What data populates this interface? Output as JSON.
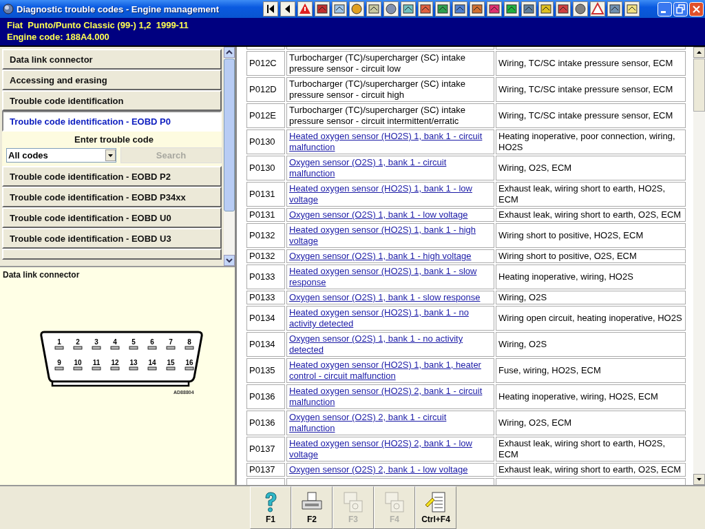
{
  "window": {
    "title": "Diagnostic trouble codes - Engine management"
  },
  "vehicle": {
    "model": "Fiat  Punto/Punto Classic (99-) 1,2  1999-11",
    "engine_code": "Engine code: 188A4.000"
  },
  "menu": [
    {
      "label": "Data link connector",
      "selected": false
    },
    {
      "label": "Accessing and erasing",
      "selected": false
    },
    {
      "label": "Trouble code identification",
      "selected": false
    },
    {
      "label": "Trouble code identification - EOBD P0",
      "selected": true
    },
    {
      "label": "Trouble code identification - EOBD P2",
      "selected": false
    },
    {
      "label": "Trouble code identification - EOBD P34xx",
      "selected": false
    },
    {
      "label": "Trouble code identification - EOBD U0",
      "selected": false
    },
    {
      "label": "Trouble code identification - EOBD U3",
      "selected": false
    }
  ],
  "code_search": {
    "title": "Enter trouble code",
    "filter": "All codes",
    "search_button": {
      "label": "Search",
      "disabled": true
    }
  },
  "diagram": {
    "title": "Data link connector",
    "pins": [
      "1",
      "2",
      "3",
      "4",
      "5",
      "6",
      "7",
      "8",
      "9",
      "10",
      "11",
      "12",
      "13",
      "14",
      "15",
      "16"
    ],
    "reference": "AD88804"
  },
  "codes": [
    {
      "code": "P012C",
      "description": "Turbocharger (TC)/supercharger (SC) intake pressure sensor - circuit low",
      "cause": "Wiring, TC/SC intake pressure sensor, ECM",
      "linked": false
    },
    {
      "code": "P012D",
      "description": "Turbocharger (TC)/supercharger (SC) intake pressure sensor - circuit high",
      "cause": "Wiring, TC/SC intake pressure sensor, ECM",
      "linked": false
    },
    {
      "code": "P012E",
      "description": "Turbocharger (TC)/supercharger (SC) intake pressure sensor - circuit intermittent/erratic",
      "cause": "Wiring, TC/SC intake pressure sensor, ECM",
      "linked": false
    },
    {
      "code": "P0130",
      "description": "Heated oxygen sensor (HO2S) 1, bank 1 - circuit malfunction",
      "cause": "Heating inoperative, poor connection, wiring, HO2S",
      "linked": true
    },
    {
      "code": "P0130",
      "description": "Oxygen sensor (O2S) 1, bank 1 - circuit malfunction",
      "cause": "Wiring, O2S, ECM",
      "linked": true
    },
    {
      "code": "P0131",
      "description": "Heated oxygen sensor (HO2S) 1, bank 1 - low voltage",
      "cause": "Exhaust leak, wiring short to earth, HO2S, ECM",
      "linked": true
    },
    {
      "code": "P0131",
      "description": "Oxygen sensor (O2S) 1, bank 1 - low voltage",
      "cause": "Exhaust leak, wiring short to earth, O2S, ECM",
      "linked": true
    },
    {
      "code": "P0132",
      "description": "Heated oxygen sensor (HO2S) 1, bank 1 - high voltage",
      "cause": "Wiring short to positive, HO2S, ECM",
      "linked": true
    },
    {
      "code": "P0132",
      "description": "Oxygen sensor (O2S) 1, bank 1 - high voltage",
      "cause": "Wiring short to positive, O2S, ECM",
      "linked": true
    },
    {
      "code": "P0133",
      "description": "Heated oxygen sensor (HO2S) 1, bank 1 - slow response",
      "cause": "Heating inoperative, wiring, HO2S",
      "linked": true
    },
    {
      "code": "P0133",
      "description": "Oxygen sensor (O2S) 1, bank 1 - slow response",
      "cause": "Wiring, O2S",
      "linked": true
    },
    {
      "code": "P0134",
      "description": "Heated oxygen sensor (HO2S) 1, bank 1 - no activity detected",
      "cause": "Wiring open circuit, heating inoperative, HO2S",
      "linked": true
    },
    {
      "code": "P0134",
      "description": "Oxygen sensor (O2S) 1, bank 1 - no activity detected",
      "cause": "Wiring, O2S",
      "linked": true
    },
    {
      "code": "P0135",
      "description": "Heated oxygen sensor (HO2S) 1, bank 1, heater control - circuit malfunction",
      "cause": "Fuse, wiring, HO2S, ECM",
      "linked": true
    },
    {
      "code": "P0136",
      "description": "Heated oxygen sensor (HO2S) 2, bank 1 - circuit malfunction",
      "cause": "Heating inoperative, wiring, HO2S, ECM",
      "linked": true
    },
    {
      "code": "P0136",
      "description": "Oxygen sensor (O2S) 2, bank 1 - circuit malfunction",
      "cause": "Wiring, O2S, ECM",
      "linked": true
    },
    {
      "code": "P0137",
      "description": "Heated oxygen sensor (HO2S) 2, bank 1 - low voltage",
      "cause": "Exhaust leak, wiring short to earth, HO2S, ECM",
      "linked": true
    },
    {
      "code": "P0137",
      "description": "Oxygen sensor (O2S) 2, bank 1 - low voltage",
      "cause": "Exhaust leak, wiring short to earth, O2S, ECM",
      "linked": true
    }
  ],
  "function_keys": [
    {
      "label": "F1",
      "disabled": false
    },
    {
      "label": "F2",
      "disabled": false
    },
    {
      "label": "F3",
      "disabled": true
    },
    {
      "label": "F4",
      "disabled": true
    },
    {
      "label": "Ctrl+F4",
      "disabled": false
    }
  ]
}
